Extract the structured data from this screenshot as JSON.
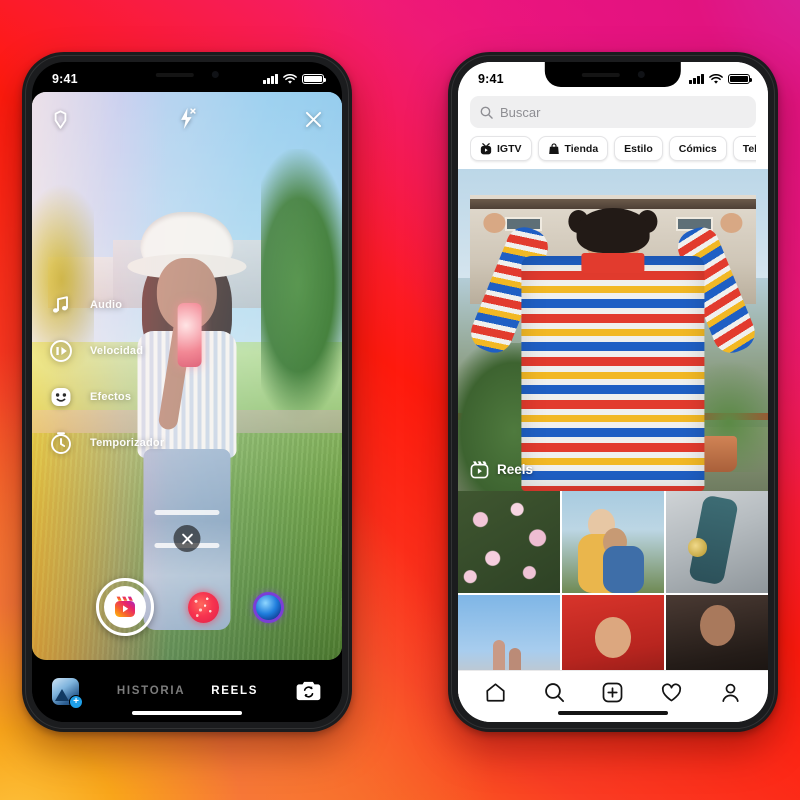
{
  "background": {
    "gradient_colors": [
      "#F9A51A",
      "#FA3C23",
      "#FF1A0D",
      "#F41D70",
      "#F20A91"
    ],
    "description": "Instagram brand gradient"
  },
  "left_phone": {
    "status_bar": {
      "time": "9:41",
      "signal": "signal-bars",
      "wifi": "wifi-icon",
      "battery": "battery-icon"
    },
    "camera": {
      "top_controls": [
        {
          "name": "settings-icon",
          "label": "Ajustes"
        },
        {
          "name": "flash-off-icon",
          "label": "Flash desactivado"
        },
        {
          "name": "close-icon",
          "label": "Cerrar"
        }
      ],
      "tools": [
        {
          "icon": "music-note-icon",
          "label": "Audio"
        },
        {
          "icon": "speed-icon",
          "label": "Velocidad"
        },
        {
          "icon": "effects-face-icon",
          "label": "Efectos"
        },
        {
          "icon": "timer-icon",
          "label": "Temporizador"
        }
      ],
      "cancel_label": "×",
      "shutter": {
        "name": "reels-record-button",
        "icon": "reels-clapperboard-icon"
      },
      "effect_thumbs": [
        {
          "name": "effect-confetti",
          "color": "#F7344F"
        },
        {
          "name": "effect-orb",
          "color": "#1F7DDD"
        }
      ]
    },
    "bottom_bar": {
      "gallery": {
        "name": "gallery-thumbnail",
        "badge": "+"
      },
      "tabs": [
        {
          "label": "HISTORIA",
          "active": false
        },
        {
          "label": "REELS",
          "active": true
        }
      ],
      "flip_camera": {
        "name": "flip-camera-icon",
        "label": "Cambiar cámara"
      }
    }
  },
  "right_phone": {
    "status_bar": {
      "time": "9:41",
      "signal": "signal-bars",
      "wifi": "wifi-icon",
      "battery": "battery-icon"
    },
    "search": {
      "placeholder": "Buscar",
      "icon": "search-icon",
      "value": ""
    },
    "category_pills": [
      {
        "label": "IGTV",
        "icon": "igtv-icon"
      },
      {
        "label": "Tienda",
        "icon": "shopping-bag-icon"
      },
      {
        "label": "Estilo",
        "icon": ""
      },
      {
        "label": "Cómics",
        "icon": ""
      },
      {
        "label": "Televisión y cine",
        "icon": ""
      }
    ],
    "featured": {
      "badge_label": "Reels",
      "badge_icon": "reels-clapperboard-icon"
    },
    "grid_cells": [
      {
        "name": "grid-cell-flowers"
      },
      {
        "name": "grid-cell-friends-hug"
      },
      {
        "name": "grid-cell-skateboard"
      },
      {
        "name": "grid-cell-hands"
      },
      {
        "name": "grid-cell-red-jacket"
      },
      {
        "name": "grid-cell-portrait"
      }
    ],
    "bottom_nav": [
      {
        "name": "nav-home",
        "label": "Inicio"
      },
      {
        "name": "nav-search",
        "label": "Buscar"
      },
      {
        "name": "nav-add",
        "label": "Crear"
      },
      {
        "name": "nav-activity",
        "label": "Actividad"
      },
      {
        "name": "nav-profile",
        "label": "Perfil"
      }
    ]
  }
}
